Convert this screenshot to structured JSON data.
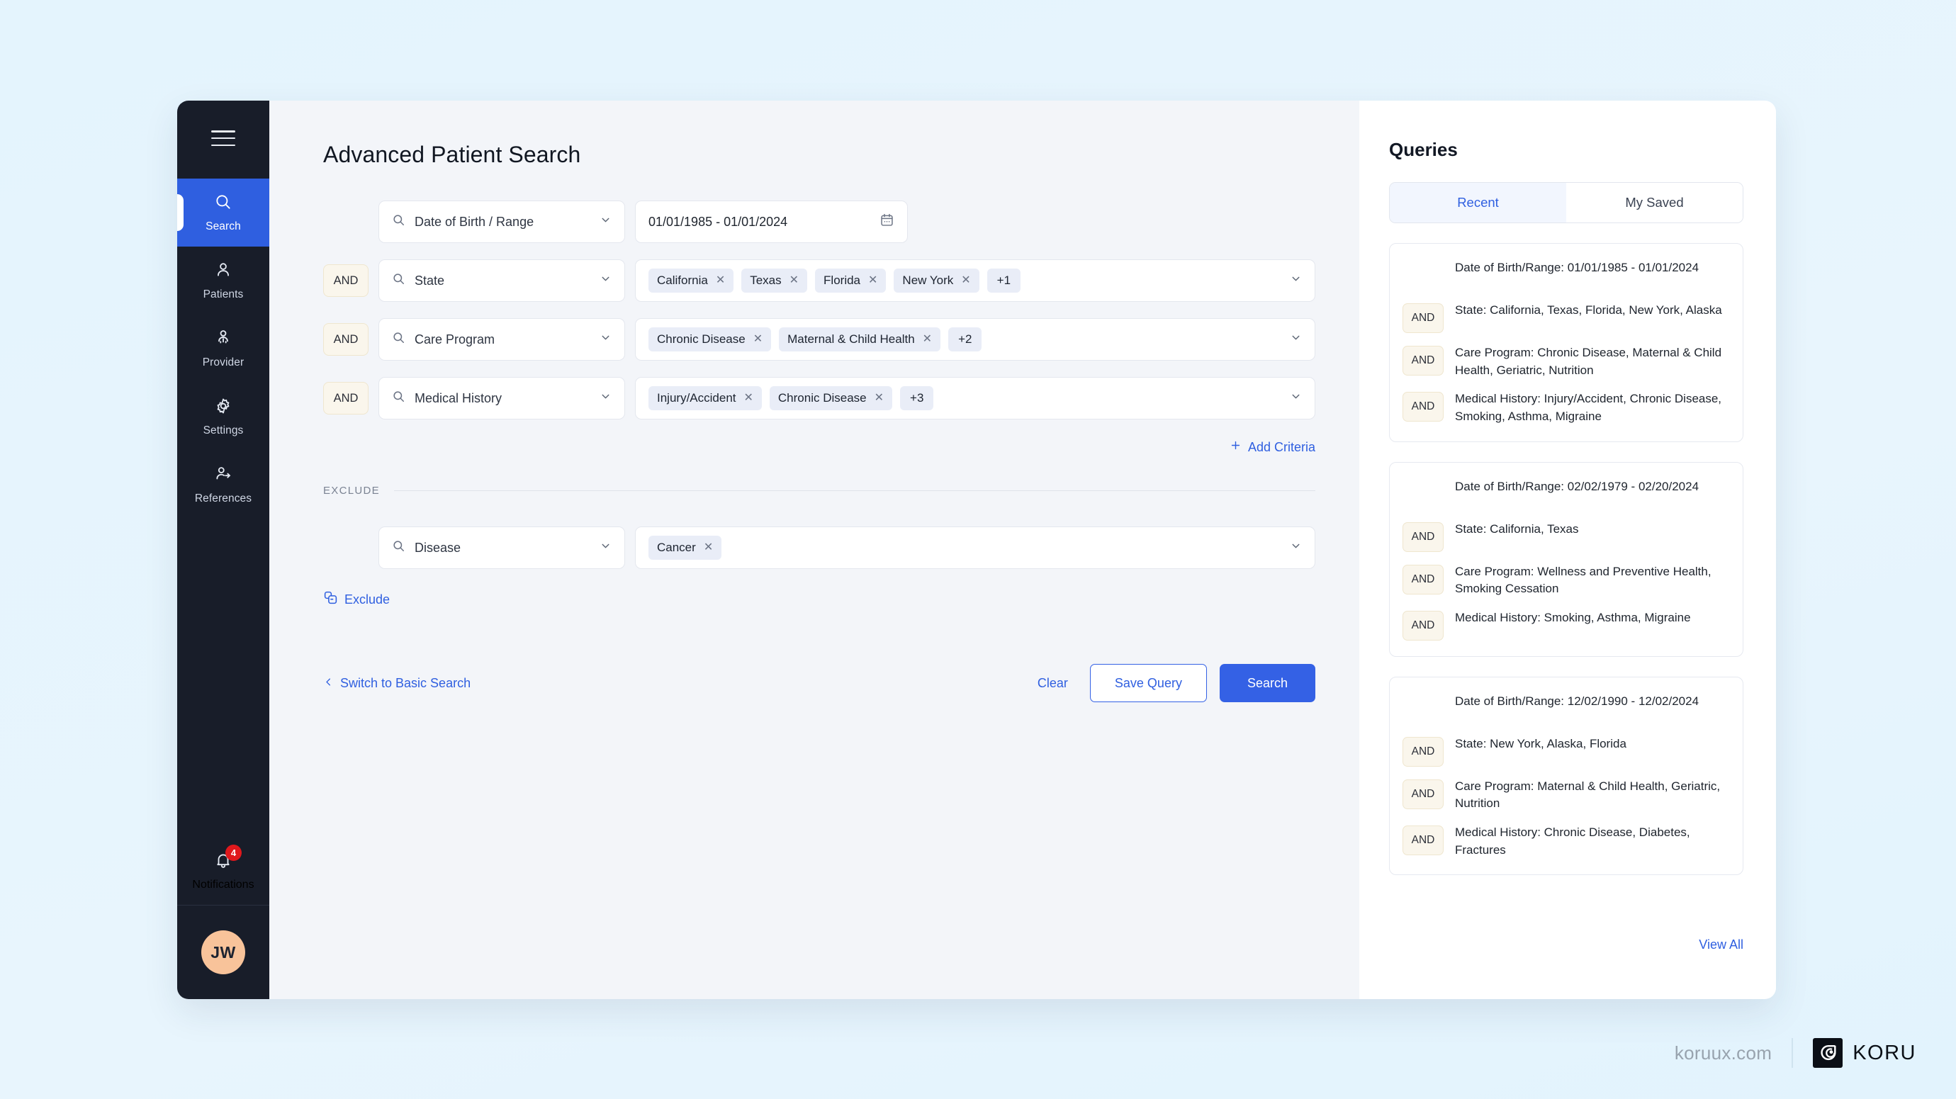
{
  "sidebar": {
    "menu_icon": "hamburger-icon",
    "items": [
      {
        "label": "Search",
        "icon": "search-icon",
        "active": true
      },
      {
        "label": "Patients",
        "icon": "user-icon",
        "active": false
      },
      {
        "label": "Provider",
        "icon": "provider-icon",
        "active": false
      },
      {
        "label": "Settings",
        "icon": "gear-icon",
        "active": false
      },
      {
        "label": "References",
        "icon": "user-share-icon",
        "active": false
      }
    ],
    "notifications": {
      "label": "Notifications",
      "icon": "bell-icon",
      "badge": "4"
    },
    "avatar": {
      "initials": "JW"
    }
  },
  "main": {
    "title": "Advanced Patient Search",
    "rows": [
      {
        "connector": "",
        "field": "Date of Birth / Range",
        "type": "date",
        "date_value": "01/01/1985 - 01/01/2024",
        "chips": []
      },
      {
        "connector": "AND",
        "field": "State",
        "type": "chips",
        "chips": [
          {
            "label": "California",
            "removable": true
          },
          {
            "label": "Texas",
            "removable": true
          },
          {
            "label": "Florida",
            "removable": true
          },
          {
            "label": "New York",
            "removable": true
          },
          {
            "label": "+1",
            "removable": false
          }
        ]
      },
      {
        "connector": "AND",
        "field": "Care Program",
        "type": "chips",
        "chips": [
          {
            "label": "Chronic Disease",
            "removable": true
          },
          {
            "label": "Maternal & Child Health",
            "removable": true
          },
          {
            "label": "+2",
            "removable": false
          }
        ]
      },
      {
        "connector": "AND",
        "field": "Medical History",
        "type": "chips",
        "chips": [
          {
            "label": "Injury/Accident",
            "removable": true
          },
          {
            "label": "Chronic Disease",
            "removable": true
          },
          {
            "label": "+3",
            "removable": false
          }
        ]
      }
    ],
    "add_criteria": "Add Criteria",
    "exclude_divider_label": "EXCLUDE",
    "exclude_row": {
      "field": "Disease",
      "chips": [
        {
          "label": "Cancer",
          "removable": true
        }
      ]
    },
    "exclude_link": "Exclude",
    "switch_link": "Switch to Basic Search",
    "clear": "Clear",
    "save_query": "Save Query",
    "search": "Search"
  },
  "queries": {
    "title": "Queries",
    "tabs": [
      {
        "label": "Recent",
        "active": true
      },
      {
        "label": "My Saved",
        "active": false
      }
    ],
    "cards": [
      {
        "lines": [
          {
            "connector": "",
            "text": "Date of Birth/Range: 01/01/1985 - 01/01/2024"
          },
          {
            "connector": "AND",
            "text": "State: California, Texas, Florida, New York, Alaska"
          },
          {
            "connector": "AND",
            "text": "Care Program: Chronic Disease, Maternal & Child Health, Geriatric, Nutrition"
          },
          {
            "connector": "AND",
            "text": "Medical History: Injury/Accident, Chronic Disease, Smoking, Asthma, Migraine"
          }
        ]
      },
      {
        "lines": [
          {
            "connector": "",
            "text": "Date of Birth/Range: 02/02/1979 - 02/20/2024"
          },
          {
            "connector": "AND",
            "text": "State: California, Texas"
          },
          {
            "connector": "AND",
            "text": "Care Program: Wellness and Preventive Health, Smoking Cessation"
          },
          {
            "connector": "AND",
            "text": "Medical History: Smoking, Asthma, Migraine"
          }
        ]
      },
      {
        "lines": [
          {
            "connector": "",
            "text": "Date of Birth/Range: 12/02/1990 - 12/02/2024"
          },
          {
            "connector": "AND",
            "text": "State: New York, Alaska, Florida"
          },
          {
            "connector": "AND",
            "text": "Care Program: Maternal & Child Health, Geriatric, Nutrition"
          },
          {
            "connector": "AND",
            "text": "Medical History: Chronic Disease, Diabetes, Fractures"
          }
        ]
      }
    ],
    "view_all": "View All"
  },
  "footer": {
    "site": "koruux.com",
    "brand_name": "KORU"
  },
  "colors": {
    "accent": "#3461e5",
    "sidebar_bg": "#181d29",
    "page_bg": "#e4f4fd",
    "chip_bg": "#e9edf7",
    "and_badge_bg": "#faf6ec",
    "badge_red": "#e0181c",
    "avatar_bg": "#f8c39a"
  }
}
